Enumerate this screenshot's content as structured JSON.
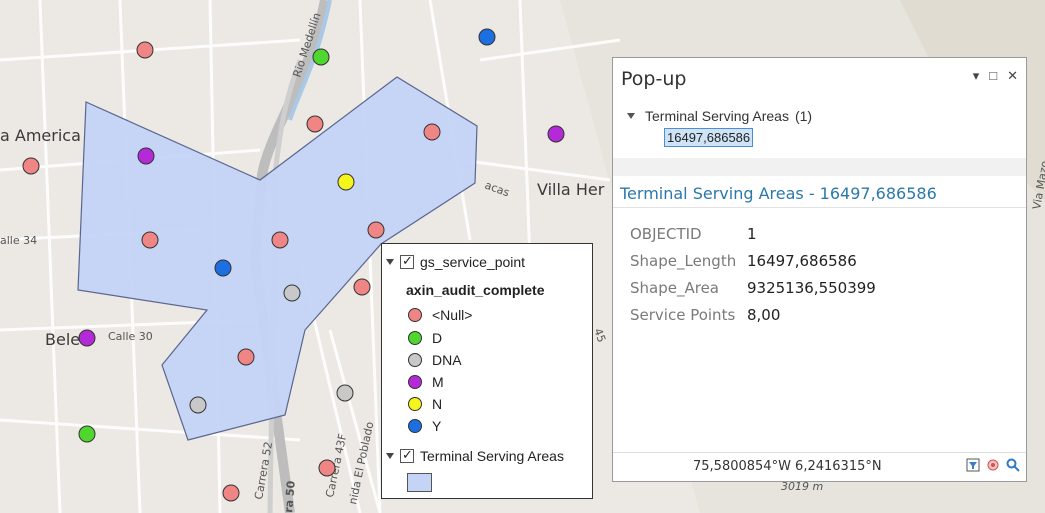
{
  "map": {
    "labels": {
      "la_america": "a America",
      "villa_hermosa": "Villa Her",
      "belen": "Bele",
      "rio_medellin": "Rio Medellín",
      "calle_34": "alle 34",
      "calle_30": "Calle 30",
      "carrera_52": "Carrera 52",
      "carrera_50": "ra 50",
      "carrera_43f": "Carrera 43F",
      "el_poblado": "nida El Poblado",
      "cacas": "acas",
      "elevation": "3019 m",
      "via_mazo": "Via Mazo",
      "num_45": "45"
    },
    "colors": {
      "polygon_fill": "#c4d3f6",
      "polygon_stroke": "#5a6690",
      "null": "#f08585",
      "D": "#4fd62f",
      "DNA": "#c8c8c8",
      "M": "#b52ad8",
      "N": "#f5f51c",
      "Y": "#1c6fe0"
    }
  },
  "legend": {
    "layer1": "gs_service_point",
    "field": "axin_audit_complete",
    "classes": [
      {
        "label": "<Null>",
        "color": "#f08585"
      },
      {
        "label": "D",
        "color": "#4fd62f"
      },
      {
        "label": "DNA",
        "color": "#c8c8c8"
      },
      {
        "label": "M",
        "color": "#b52ad8"
      },
      {
        "label": "N",
        "color": "#f5f51c"
      },
      {
        "label": "Y",
        "color": "#1c6fe0"
      }
    ],
    "layer2": "Terminal Serving Areas"
  },
  "popup": {
    "title": "Pop-up",
    "controls": {
      "menu": "▾",
      "maximize": "□",
      "close": "✕"
    },
    "tree_layer": "Terminal Serving Areas",
    "tree_count": "(1)",
    "selected_feature": "16497,686586",
    "feature_title": "Terminal Serving Areas - 16497,686586",
    "attributes": [
      {
        "name": "OBJECTID",
        "value": "1"
      },
      {
        "name": "Shape_Length",
        "value": "16497,686586"
      },
      {
        "name": "Shape_Area",
        "value": "9325136,550399"
      },
      {
        "name": "Service Points",
        "value": "8,00"
      }
    ],
    "coordinates": "75,5800854°W 6,2416315°N",
    "status_icons": [
      "filter-icon",
      "flash-icon",
      "zoom-to-icon"
    ]
  }
}
